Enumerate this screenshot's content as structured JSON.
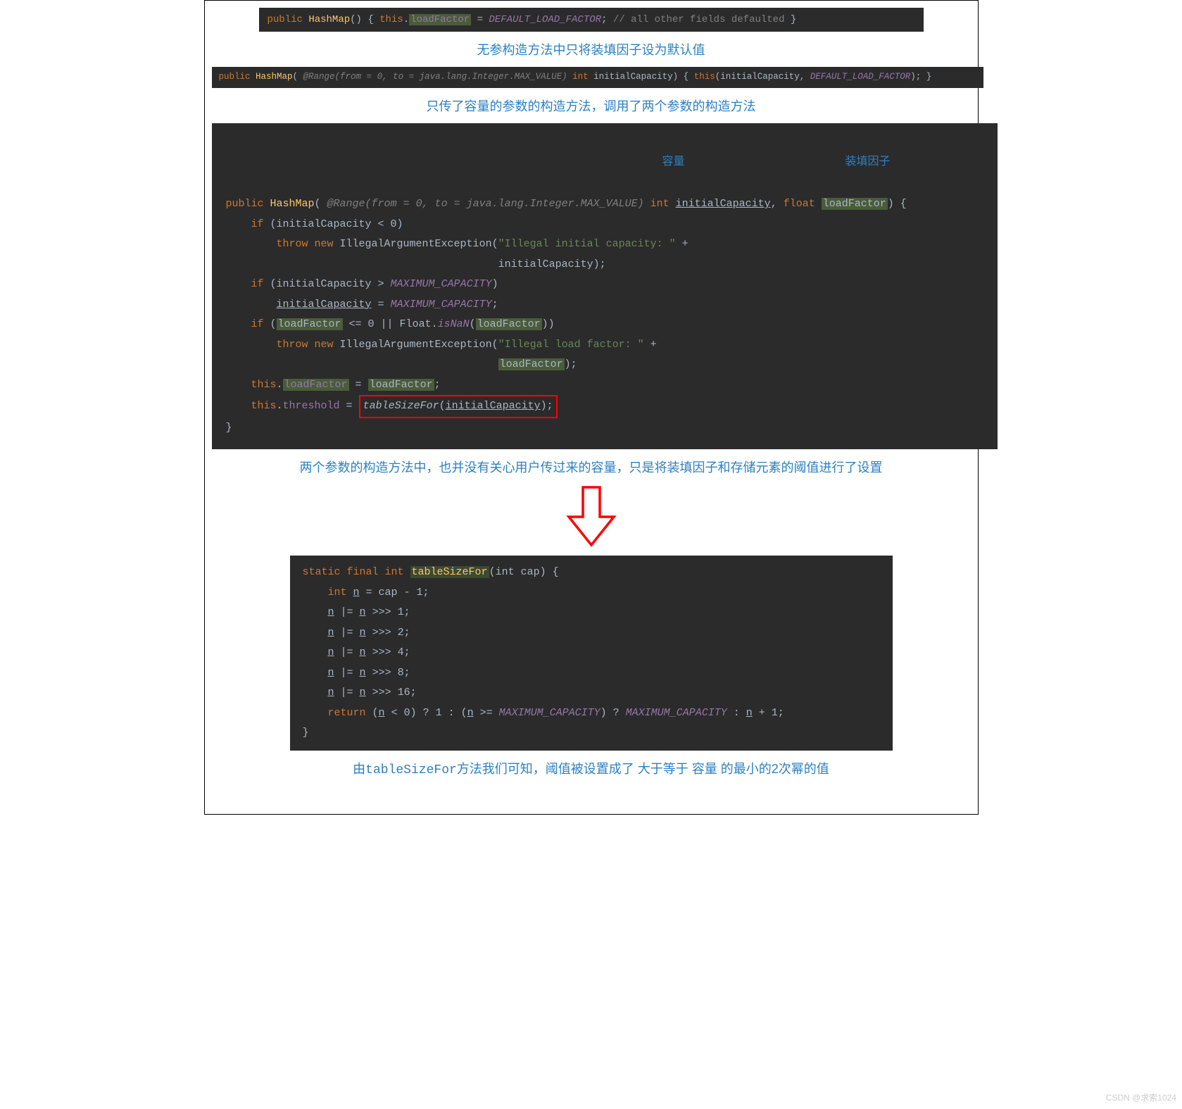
{
  "anno1": "无参构造方法中只将装填因子设为默认值",
  "anno2": "只传了容量的参数的构造方法，调用了两个参数的构造方法",
  "anno3": "两个参数的构造方法中，也并没有关心用户传过来的容量，只是将装填因子和存储元素的阈值进行了设置",
  "anno4_pre": "由",
  "anno4_method": "tableSizeFor",
  "anno4_post": "方法我们可知，阈值被设置成了 大于等于 容量 的最小的2次幂的值",
  "label_capacity": "容量",
  "label_loadfactor": "装填因子",
  "code1": {
    "public": "public ",
    "hashmap": "HashMap",
    "parens": "() { ",
    "thisk": "this",
    "dot": ".",
    "lf": "loadFactor",
    "eq": " = ",
    "def": "DEFAULT_LOAD_FACTOR",
    "semi": "; ",
    "cmt": "// all other fields defaulted",
    "close": " }"
  },
  "code2": {
    "public": "public ",
    "hashmap": "HashMap",
    "open": "( ",
    "range": "@Range(from = 0, to = java.lang.Integer.MAX_VALUE)",
    "sp": " ",
    "intk": "int ",
    "ic": "initialCapacity",
    "mid": ") { ",
    "thisk": "this",
    "call": "(initialCapacity, ",
    "def": "DEFAULT_LOAD_FACTOR",
    "end": "); }"
  },
  "code3": {
    "l1_public": "public ",
    "l1_hashmap": "HashMap",
    "l1_open": "( ",
    "l1_range": "@Range(from = 0, to = java.lang.Integer.MAX_VALUE)",
    "l1_sp": " ",
    "l1_int": "int ",
    "l1_ic": "initialCapacity",
    "l1_comma": ", ",
    "l1_float": "float ",
    "l1_lf": "loadFactor",
    "l1_end": ") {",
    "l2_if": "    if ",
    "l2_cond": "(initialCapacity < 0)",
    "l3_throw": "        throw new ",
    "l3_ex": "IllegalArgumentException(",
    "l3_str": "\"Illegal initial capacity: \"",
    "l3_plus": " +",
    "l4_pad": "                                           ",
    "l4_ic": "initialCapacity);",
    "l5_if": "    if ",
    "l5_open": "(initialCapacity > ",
    "l5_max": "MAXIMUM_CAPACITY",
    "l5_close": ")",
    "l6_pad": "        ",
    "l6_ic": "initialCapacity",
    "l6_eq": " = ",
    "l6_max": "MAXIMUM_CAPACITY",
    "l6_semi": ";",
    "l7_if": "    if ",
    "l7_open": "(",
    "l7_lf1": "loadFactor",
    "l7_mid": " <= 0 || Float.",
    "l7_isnan": "isNaN",
    "l7_open2": "(",
    "l7_lf2": "loadFactor",
    "l7_close": "))",
    "l8_throw": "        throw new ",
    "l8_ex": "IllegalArgumentException(",
    "l8_str": "\"Illegal load factor: \"",
    "l8_plus": " +",
    "l9_pad": "                                           ",
    "l9_lf": "loadFactor",
    "l9_close": ");",
    "l10_this": "    this",
    "l10_dot": ".",
    "l10_lf1": "loadFactor",
    "l10_eq": " = ",
    "l10_lf2": "loadFactor",
    "l10_semi": ";",
    "l11_this": "    this",
    "l11_dot": ".",
    "l11_thr": "threshold",
    "l11_eq": " = ",
    "l11_tsf": "tableSizeFor",
    "l11_open": "(",
    "l11_ic": "initialCapacity",
    "l11_close": ");",
    "l12": "}"
  },
  "code4": {
    "l1_static": "static final int ",
    "l1_tsf": "tableSizeFor",
    "l1_params": "(int cap) {",
    "l2_int": "    int ",
    "l2_n": "n",
    "l2_rest": " = cap - 1;",
    "l3_pad": "    ",
    "l3_n1": "n",
    "l3_mid": " |= ",
    "l3_n2": "n",
    "l3_end": " >>> 1;",
    "l4_end": " >>> 2;",
    "l5_end": " >>> 4;",
    "l6_end": " >>> 8;",
    "l7_end": " >>> 16;",
    "l8_ret": "    return ",
    "l8_open": "(",
    "l8_n1": "n",
    "l8_lt": " < 0) ? 1 : (",
    "l8_n2": "n",
    "l8_ge": " >= ",
    "l8_max1": "MAXIMUM_CAPACITY",
    "l8_q": ") ? ",
    "l8_max2": "MAXIMUM_CAPACITY",
    "l8_colon": " : ",
    "l8_n3": "n",
    "l8_end": " + 1;",
    "l9": "}"
  },
  "watermark": "CSDN @求索1024"
}
